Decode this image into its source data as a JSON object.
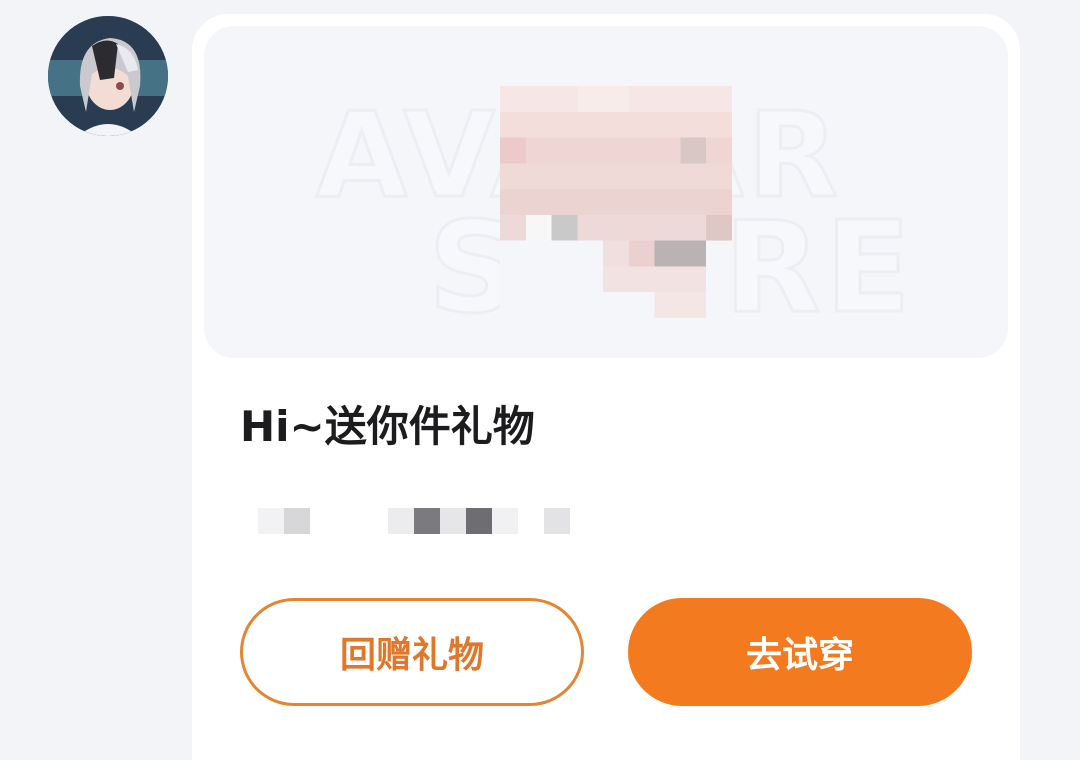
{
  "message": {
    "sender_avatar": "avatar-icon",
    "card": {
      "banner_watermark_line1": "AVATAR",
      "banner_watermark_line2": "STORE",
      "title": "Hi~送你件礼物",
      "buttons": {
        "gift_back_label": "回赠礼物",
        "try_on_label": "去试穿"
      }
    }
  },
  "colors": {
    "accent": "#f47a20",
    "accent_text": "#e0782c",
    "card_bg": "#ffffff",
    "page_bg": "#f3f4f8",
    "title_text": "#1c1c1e"
  }
}
